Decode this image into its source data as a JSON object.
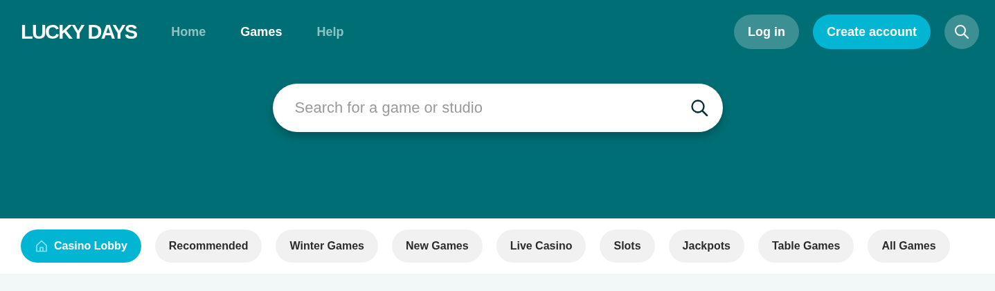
{
  "header": {
    "logo": "LUCKY DAYS",
    "nav": [
      {
        "label": "Home",
        "selected": false
      },
      {
        "label": "Games",
        "selected": true
      },
      {
        "label": "Help",
        "selected": false
      }
    ],
    "login": "Log in",
    "create_account": "Create account"
  },
  "search": {
    "placeholder": "Search for a game or studio"
  },
  "categories": [
    {
      "label": "Casino Lobby",
      "selected": true,
      "kind": "home"
    },
    {
      "label": "Recommended",
      "selected": false,
      "kind": "plain"
    },
    {
      "label": "Winter Games",
      "selected": false,
      "kind": "plain"
    },
    {
      "label": "New Games",
      "selected": false,
      "kind": "plain"
    },
    {
      "label": "Live Casino",
      "selected": false,
      "kind": "plain"
    },
    {
      "label": "Slots",
      "selected": false,
      "kind": "plain"
    },
    {
      "label": "Jackpots",
      "selected": false,
      "kind": "plain"
    },
    {
      "label": "Table Games",
      "selected": false,
      "kind": "plain"
    },
    {
      "label": "All Games",
      "selected": false,
      "kind": "plain"
    }
  ]
}
